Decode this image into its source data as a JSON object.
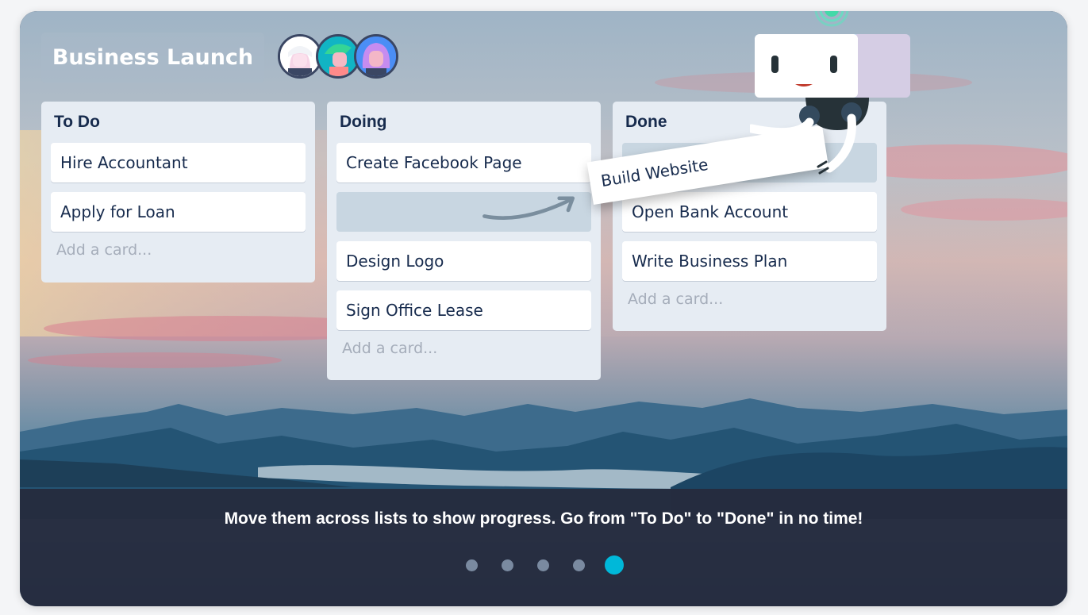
{
  "board": {
    "title": "Business Launch",
    "members": [
      "avatar-1",
      "avatar-2",
      "avatar-3"
    ]
  },
  "lists": [
    {
      "title": "To Do",
      "cards": [
        "Hire Accountant",
        "Apply for Loan"
      ],
      "add_label": "Add a card..."
    },
    {
      "title": "Doing",
      "cards": [
        "Create Facebook Page",
        "",
        "Design Logo",
        "Sign Office Lease"
      ],
      "add_label": "Add a card..."
    },
    {
      "title": "Done",
      "cards": [
        "",
        "Open Bank Account",
        "Write Business Plan"
      ],
      "add_label": "Add a card..."
    }
  ],
  "dragged_card": "Build Website",
  "caption": "Move them across lists to show progress. Go from \"To Do\" to \"Done\" in no time!",
  "carousel": {
    "slides": 5,
    "active": 5
  },
  "colors": {
    "accent": "#00b8d9",
    "list_bg": "#e6ecf3",
    "text": "#172b4d",
    "band": "#262a3c"
  }
}
